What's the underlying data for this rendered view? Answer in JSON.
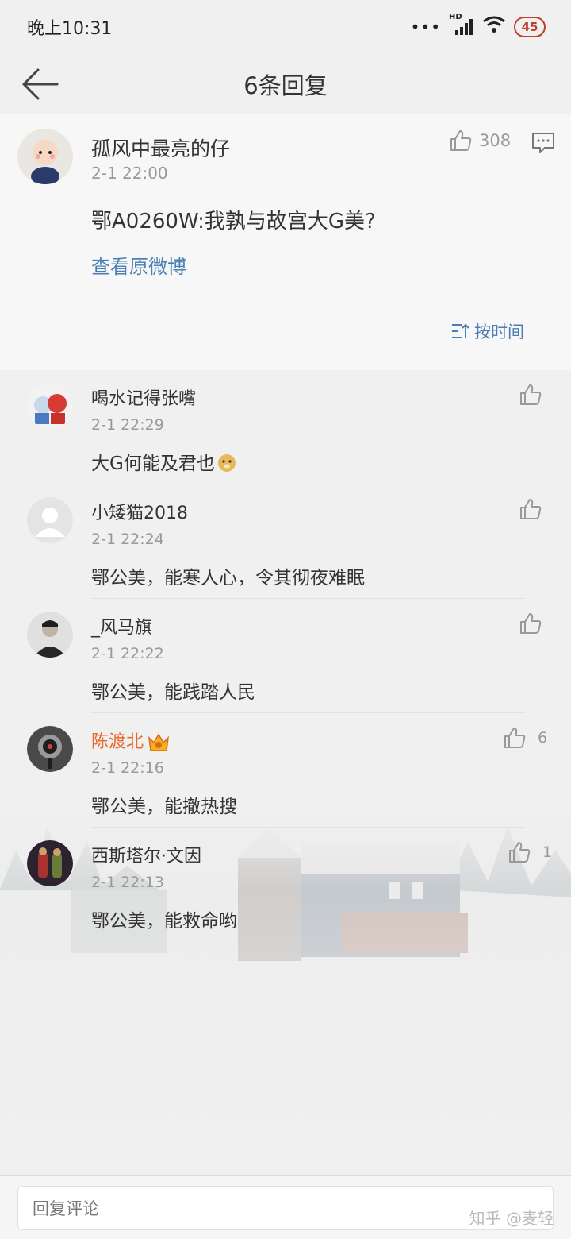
{
  "status_bar": {
    "time": "晚上10:31",
    "network": "HD",
    "battery": "45"
  },
  "nav": {
    "title": "6条回复"
  },
  "main_post": {
    "username": "孤风中最亮的仔",
    "time": "2-1 22:00",
    "content": "鄂A0260W:我孰与故宫大G美?",
    "view_original": "查看原微博",
    "likes": "308",
    "sort_label": "按时间"
  },
  "replies": [
    {
      "username": "喝水记得张嘴",
      "time": "2-1 22:29",
      "content": "大G何能及君也",
      "likes": ""
    },
    {
      "username": "小矮猫2018",
      "time": "2-1 22:24",
      "content": "鄂公美，能寒人心，令其彻夜难眠",
      "likes": ""
    },
    {
      "username": "_风马旗",
      "time": "2-1 22:22",
      "content": "鄂公美，能践踏人民",
      "likes": ""
    },
    {
      "username": "陈渡北",
      "time": "2-1 22:16",
      "content": "鄂公美，能撤热搜",
      "likes": "6"
    },
    {
      "username": "西斯塔尔·文因",
      "time": "2-1 22:13",
      "content": "鄂公美，能救命哟",
      "likes": "1"
    }
  ],
  "bottom_bar": {
    "placeholder": "回复评论"
  },
  "watermark": "知乎 @麦轻",
  "colors": {
    "link": "#4a7fb5",
    "vip_name": "#e8692b",
    "battery": "#c23d2b"
  }
}
